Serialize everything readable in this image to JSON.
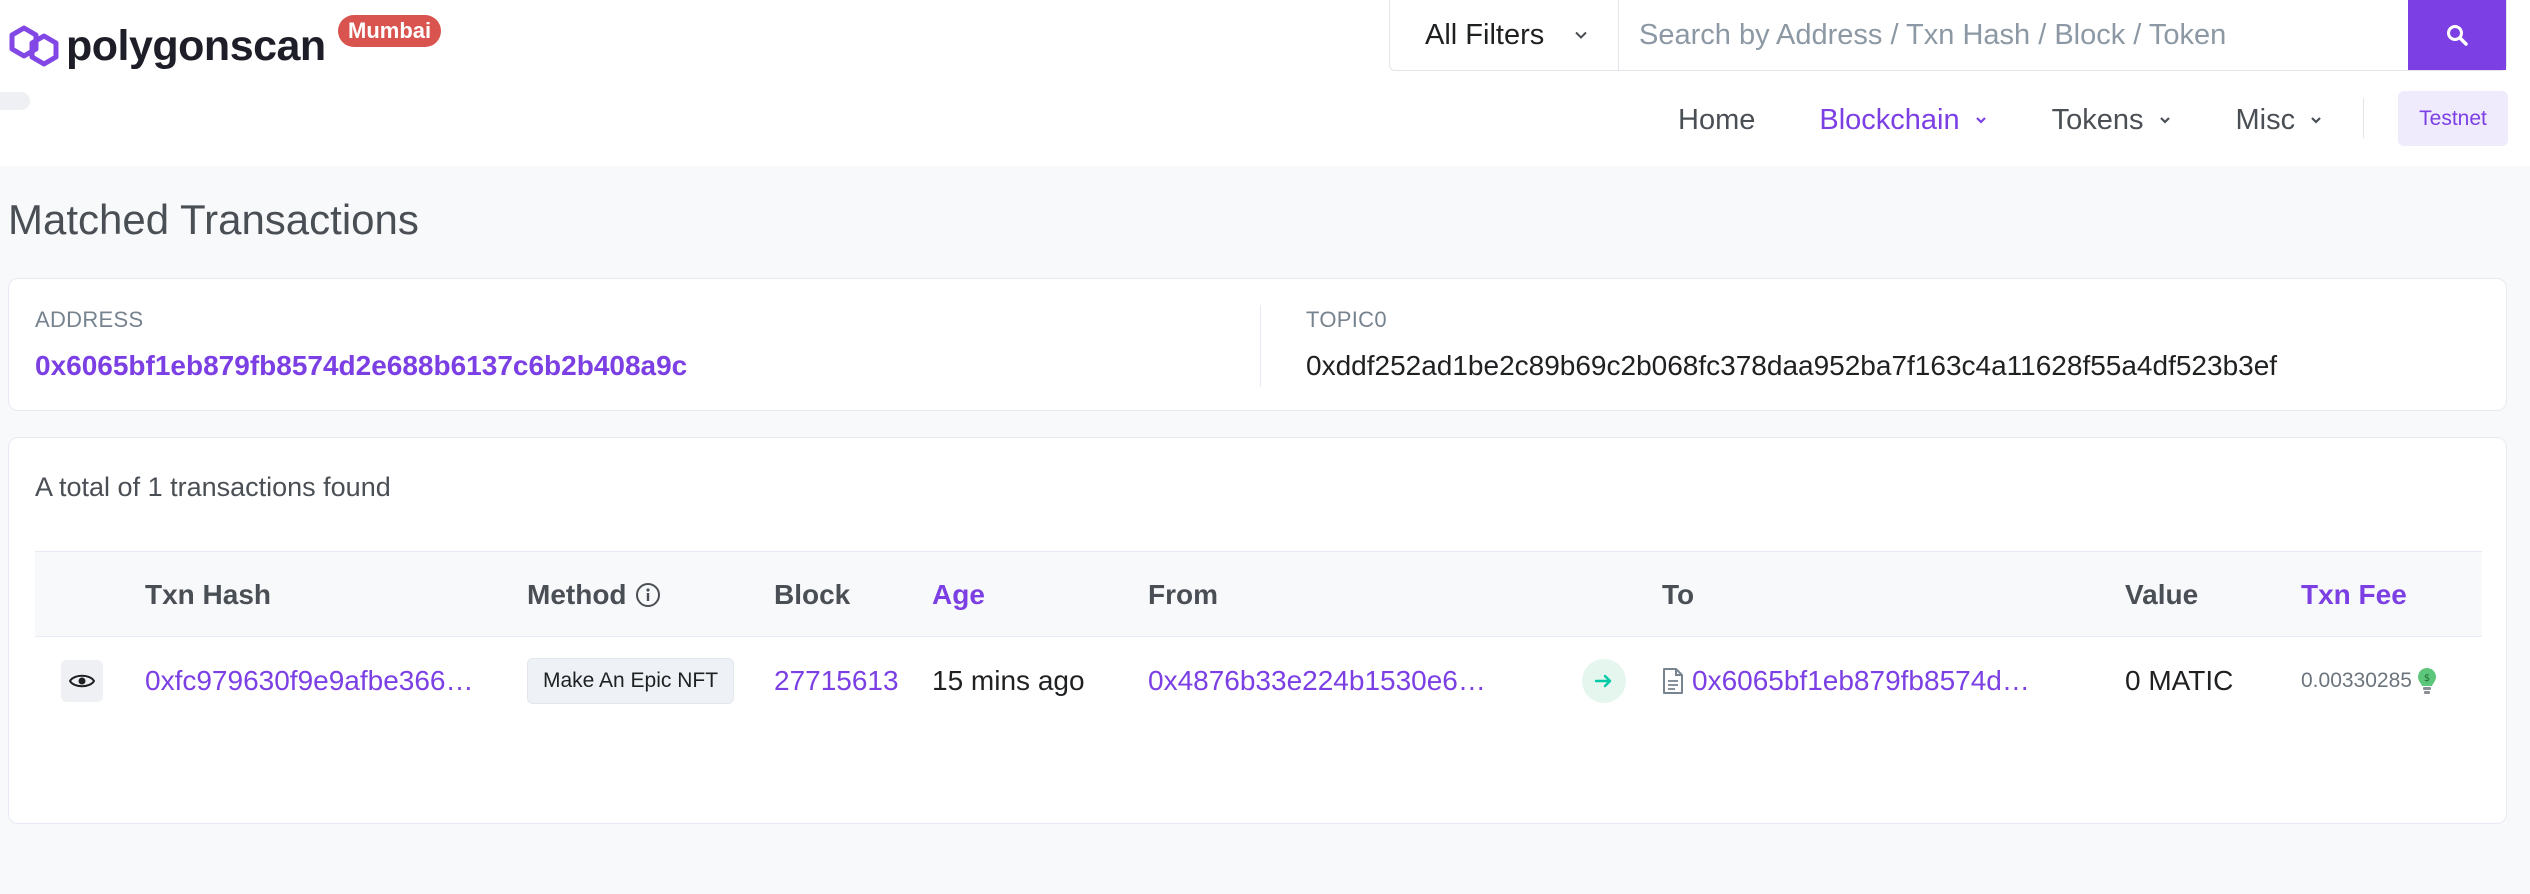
{
  "header": {
    "logo_text": "polygonscan",
    "network_badge": "Mumbai",
    "search": {
      "filter_label": "All Filters",
      "placeholder": "Search by Address / Txn Hash / Block / Token"
    },
    "nav": {
      "items": [
        "Home",
        "Blockchain",
        "Tokens",
        "Misc"
      ],
      "active": "Blockchain",
      "testnet_label": "Testnet"
    }
  },
  "page": {
    "title": "Matched Transactions",
    "filters": {
      "address_label": "ADDRESS",
      "address_value": "0x6065bf1eb879fb8574d2e688b6137c6b2b408a9c",
      "topic_label": "TOPIC0",
      "topic_value": "0xddf252ad1be2c89b69c2b068fc378daa952ba7f163c4a11628f55a4df523b3ef"
    },
    "total_text": "A total of 1 transactions found",
    "table": {
      "headers": {
        "txn_hash": "Txn Hash",
        "method": "Method",
        "block": "Block",
        "age": "Age",
        "from": "From",
        "to": "To",
        "value": "Value",
        "txn_fee": "Txn Fee"
      },
      "rows": [
        {
          "txn_hash": "0xfc979630f9e9afbe366…",
          "method": "Make An Epic NFT",
          "block": "27715613",
          "age": "15 mins ago",
          "from": "0x4876b33e224b1530e6…",
          "to": "0x6065bf1eb879fb8574d…",
          "value": "0 MATIC",
          "txn_fee": "0.00330285"
        }
      ]
    }
  },
  "colors": {
    "brand_purple": "#7b3fe4",
    "badge_red": "#d9534f",
    "in_green": "#00c9a7"
  }
}
